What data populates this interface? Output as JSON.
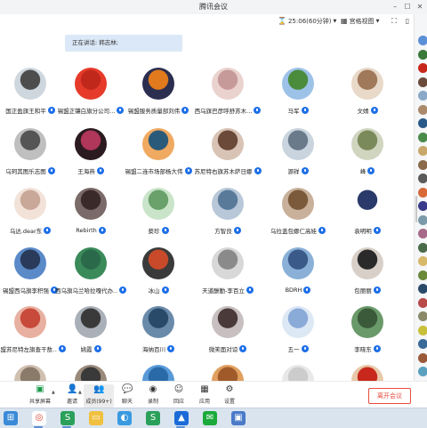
{
  "window": {
    "title": "腾讯会议"
  },
  "topbar": {
    "timer": "25:06(60分钟)",
    "view_label": "宫格视图"
  },
  "speaking": {
    "label": "正在讲话: 韩志林;"
  },
  "participants": [
    {
      "name": "国正盈旗王和平",
      "color": "#4d4d4d",
      "bg": "#cfd7de"
    },
    {
      "name": "锡盟正镶白旗分公司...",
      "color": "#c0281c",
      "bg": "#e63b2a"
    },
    {
      "name": "锡盟服务质量部刘伟",
      "color": "#e07a1d",
      "bg": "#2b2e4f"
    },
    {
      "name": "西乌旗巴彦呼舒苏木...",
      "color": "#c79a9a",
      "bg": "#ead3cf"
    },
    {
      "name": "马军",
      "color": "#4a8b3c",
      "bg": "#9dc2e8"
    },
    {
      "name": "文婧",
      "color": "#a0785a",
      "bg": "#e8d9c8"
    },
    {
      "name": "乌珂其图乐志图",
      "color": "#555",
      "bg": "#bfbfbf"
    },
    {
      "name": "王海燕",
      "color": "#b0365a",
      "bg": "#2b1a1f"
    },
    {
      "name": "锡盟二连市场部杨大伟",
      "color": "#2a5a7a",
      "bg": "#f0a960"
    },
    {
      "name": "苏尼特右旗苏木萨日娜",
      "color": "#6b4a3a",
      "bg": "#d8c3b5"
    },
    {
      "name": "源祥",
      "color": "#6a7a8a",
      "bg": "#c9d4de"
    },
    {
      "name": "峰",
      "color": "#7b8a5a",
      "bg": "#d0d5c0"
    },
    {
      "name": "乌达.dear东",
      "color": "#c9a89a",
      "bg": "#f2e2d8"
    },
    {
      "name": "Rebirth",
      "color": "#3a2a2a",
      "bg": "#7a6a68"
    },
    {
      "name": "葵珍",
      "color": "#6aa06a",
      "bg": "#c9e4c8"
    },
    {
      "name": "方智良",
      "color": "#5a7a9a",
      "bg": "#b8c8d8"
    },
    {
      "name": "乌拉盖包娜仁高娃",
      "color": "#7a5a3a",
      "bg": "#c8b09a"
    },
    {
      "name": "袁明明",
      "color": "#2a3a6a",
      "bg": "#ffffff"
    },
    {
      "name": "锡盟西乌旗李积强",
      "color": "#2a3a5a",
      "bg": "#5a8ac8"
    },
    {
      "name": "西乌旗乌兰哈拉嘎代办...",
      "color": "#2a6a4a",
      "bg": "#3a8a5a"
    },
    {
      "name": "冰山",
      "color": "#c84a2a",
      "bg": "#3a3a3a"
    },
    {
      "name": "天道酬勤-李百立",
      "color": "#8a8a8a",
      "bg": "#d8d8d8"
    },
    {
      "name": "BDRH",
      "color": "#3a5a8a",
      "bg": "#8ab0d8"
    },
    {
      "name": "包丽丽",
      "color": "#2a2a2a",
      "bg": "#d8d0c8"
    },
    {
      "name": "锡盟苏尼特左旗查干敖...",
      "color": "#c84a3a",
      "bg": "#e8b0a0"
    },
    {
      "name": "姚霞",
      "color": "#3a3a3a",
      "bg": "#aab0b8"
    },
    {
      "name": "海纳百川",
      "color": "#2a4a6a",
      "bg": "#6a8aaa"
    },
    {
      "name": "微笑面对谅",
      "color": "#4a3a3a",
      "bg": "#c8c0c0"
    },
    {
      "name": "五一",
      "color": "#8aaad8",
      "bg": "#dde8f5"
    },
    {
      "name": "李晓东",
      "color": "#3a5a3a",
      "bg": "#6a9a6a"
    },
    {
      "name": "",
      "color": "#8a7a6a",
      "bg": "#d0c0b0"
    },
    {
      "name": "",
      "color": "#3a3a3a",
      "bg": "#9a8a7a"
    },
    {
      "name": "",
      "color": "#2a6aa8",
      "bg": "#5a9ad8"
    },
    {
      "name": "",
      "color": "#a05a2a",
      "bg": "#e0a060"
    },
    {
      "name": "",
      "color": "#ccc",
      "bg": "#e8e8e8"
    },
    {
      "name": "",
      "color": "#c8281c",
      "bg": "#e8c8a8"
    }
  ],
  "toolbar": {
    "items": [
      {
        "label": "共享屏幕",
        "icon": "share-screen-icon"
      },
      {
        "label": "邀请",
        "icon": "invite-icon"
      },
      {
        "label": "成员(99+)",
        "icon": "members-icon"
      },
      {
        "label": "聊天",
        "icon": "chat-icon"
      },
      {
        "label": "录制",
        "icon": "record-icon"
      },
      {
        "label": "回应",
        "icon": "reaction-icon"
      },
      {
        "label": "应用",
        "icon": "apps-icon"
      },
      {
        "label": "设置",
        "icon": "settings-icon"
      }
    ],
    "leave_label": "离开会议"
  },
  "taskbar": {
    "apps": [
      "start-icon",
      "chrome-icon",
      "wps-icon",
      "explorer-icon",
      "browser-icon",
      "wps-writer-icon",
      "tencent-meeting-icon",
      "wechat-icon",
      "app-icon"
    ]
  },
  "sidebar_colors": [
    "#5b8fd6",
    "#3a7a3a",
    "#c8281c",
    "#6a4a3a",
    "#8aa8c8",
    "#aa8a6a",
    "#2a5a8a",
    "#4a8a4a",
    "#c8a86a",
    "#8a6a4a",
    "#5a5a5a",
    "#d86a3a",
    "#3a3a8a",
    "#7a9aaa",
    "#a86a8a",
    "#4a6a4a",
    "#d8b86a",
    "#6a8a3a",
    "#2a4a6a",
    "#b84a4a",
    "#8a8a6a",
    "#c8c03a",
    "#3a6a9a",
    "#9a5a3a",
    "#5aa0c0",
    "#aa3a3a"
  ]
}
